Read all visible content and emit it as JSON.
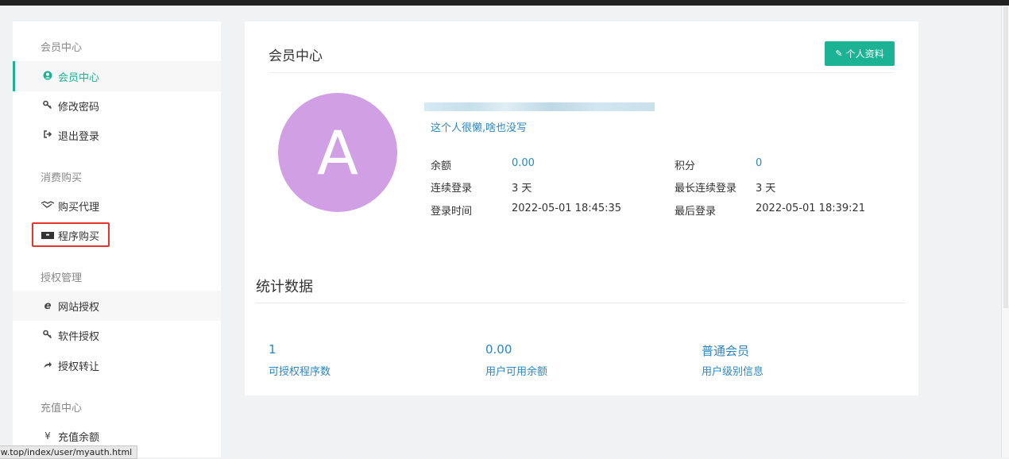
{
  "browser": {
    "status_url": "aw.top/index/user/myauth.html"
  },
  "sidebar": {
    "groups": [
      {
        "title": "会员中心",
        "items": [
          {
            "label": "会员中心",
            "icon": "user-circle-icon",
            "active": true
          },
          {
            "label": "修改密码",
            "icon": "key-icon"
          },
          {
            "label": "退出登录",
            "icon": "sign-out-icon"
          }
        ]
      },
      {
        "title": "消费购买",
        "items": [
          {
            "label": "购买代理",
            "icon": "handshake-icon"
          },
          {
            "label": "程序购买",
            "icon": "paypal-icon",
            "highlighted": true
          }
        ]
      },
      {
        "title": "授权管理",
        "items": [
          {
            "label": "网站授权",
            "icon": "ie-icon",
            "hover": true
          },
          {
            "label": "软件授权",
            "icon": "key-icon"
          },
          {
            "label": "授权转让",
            "icon": "share-icon"
          }
        ]
      },
      {
        "title": "充值中心",
        "items": [
          {
            "label": "充值余额",
            "icon": "yen-icon"
          }
        ]
      }
    ]
  },
  "profile": {
    "title": "会员中心",
    "edit_button": "个人资料",
    "avatar_letter": "A",
    "bio": "这个人很懒,啥也没写",
    "info": {
      "balance_label": "余额",
      "balance": "0.00",
      "points_label": "积分",
      "points": "0",
      "streak_label": "连续登录",
      "streak": "3 天",
      "max_streak_label": "最长连续登录",
      "max_streak": "3 天",
      "login_time_label": "登录时间",
      "login_time": "2022-05-01 18:45:35",
      "last_login_label": "最后登录",
      "last_login": "2022-05-01 18:39:21"
    }
  },
  "stats": {
    "title": "统计数据",
    "items": [
      {
        "value": "1",
        "label": "可授权程序数"
      },
      {
        "value": "0.00",
        "label": "用户可用余额"
      },
      {
        "value": "普通会员",
        "label": "用户级别信息"
      }
    ]
  },
  "colors": {
    "accent": "#1bb394",
    "link": "#2a87c2",
    "avatar_bg": "#d19fe3",
    "highlight_box": "#e8322b"
  }
}
